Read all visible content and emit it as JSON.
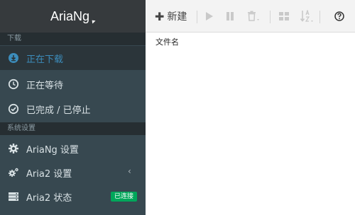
{
  "brand": {
    "name": "AriaNg"
  },
  "sidebar": {
    "download_section": "下载",
    "settings_section": "系统设置",
    "items": [
      {
        "label": "正在下载",
        "icon": "download-circle-icon",
        "active": true
      },
      {
        "label": "正在等待",
        "icon": "clock-icon"
      },
      {
        "label": "已完成 / 已停止",
        "icon": "check-circle-icon"
      },
      {
        "label": "AriaNg 设置",
        "icon": "gear-icon"
      },
      {
        "label": "Aria2 设置",
        "icon": "gears-icon",
        "chevron": "‹"
      },
      {
        "label": "Aria2 状态",
        "icon": "server-icon",
        "badge": "已连接"
      }
    ]
  },
  "toolbar": {
    "new_label": "新建",
    "icons": [
      "play-icon",
      "pause-icon",
      "trash-icon",
      "grid-icon",
      "sort-icon",
      "help-icon"
    ]
  },
  "main": {
    "column_header": "文件名"
  },
  "colors": {
    "sidebar_bg": "#374850",
    "brand_bg": "#363a3d",
    "section_bg": "#262e32",
    "active_text": "#3c8dbc",
    "badge_green": "#00a65a"
  }
}
